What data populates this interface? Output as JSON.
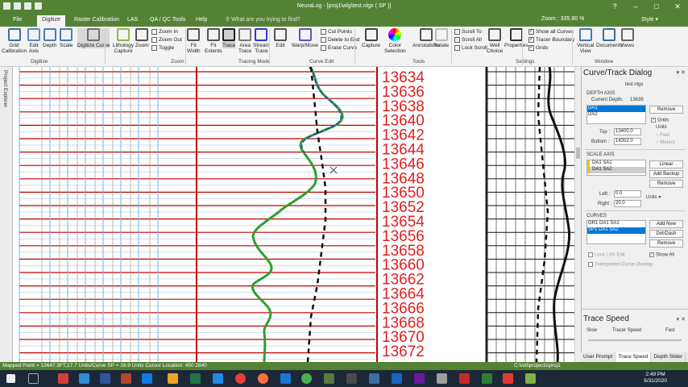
{
  "window": {
    "title": "NeuraLog - [proj1\\wlg\\test.nlgx ( SP )]"
  },
  "tabs": [
    "File",
    "Digitize",
    "Raster Calibration",
    "LAS",
    "QA / QC Tools",
    "Help"
  ],
  "active_tab": "Digitize",
  "tellme_placeholder": "What are you trying to find?",
  "zoom_label": "Zoom : 335.80 %",
  "style_label": "Style",
  "ribbon": {
    "buttons": [
      {
        "label": "Grid\nCalibration",
        "icon": "grid-calibration-icon"
      },
      {
        "label": "Edit\nAxis",
        "icon": "edit-axis-icon"
      },
      {
        "label": "Depth",
        "icon": "depth-icon"
      },
      {
        "label": "Scale",
        "icon": "scale-icon"
      },
      {
        "label": "Digitize Curve",
        "icon": "digitize-curve-icon"
      },
      {
        "label": "Lithology\nCapture",
        "icon": "lithology-icon"
      },
      {
        "label": "Zoom",
        "icon": "zoom-icon"
      },
      {
        "label": "Fit\nWidth",
        "icon": "fit-width-icon"
      },
      {
        "label": "Fit\nExtents",
        "icon": "fit-extents-icon"
      },
      {
        "label": "Trace",
        "icon": "trace-icon"
      },
      {
        "label": "Area\nTrace",
        "icon": "area-trace-icon"
      },
      {
        "label": "Stream\nTrace",
        "icon": "stream-trace-icon"
      },
      {
        "label": "Edit",
        "icon": "edit-icon"
      },
      {
        "label": "Warp/Move",
        "icon": "warp-icon"
      },
      {
        "label": "Capture",
        "icon": "capture-icon"
      },
      {
        "label": "Color\nSelection",
        "icon": "color-selection-icon"
      },
      {
        "label": "Annotations",
        "icon": "annotations-icon"
      },
      {
        "label": "Rotate",
        "icon": "rotate-icon"
      },
      {
        "label": "Well\nChoice",
        "icon": "well-choice-icon"
      },
      {
        "label": "Properties",
        "icon": "properties-icon"
      },
      {
        "label": "Vertical\nView",
        "icon": "vertical-view-icon"
      },
      {
        "label": "Documents",
        "icon": "documents-icon"
      },
      {
        "label": "Views",
        "icon": "views-icon"
      }
    ],
    "zoom_small": [
      "Zoom In",
      "Zoom Out",
      "Toggle"
    ],
    "curve_small": [
      "Cut Points",
      "Delete to End",
      "Erase Curve"
    ],
    "scroll_small": [
      "Scroll To",
      "Scroll All",
      "Lock Scroll"
    ],
    "settings_small": [
      "Show all Curves",
      "Tracer Boundary",
      "Grids"
    ],
    "groups": [
      "Digitize",
      "Zoom",
      "Tracing Mode",
      "Curve Edit",
      "Tools",
      "Settings",
      "Window"
    ]
  },
  "explorer_label": "Project Explorer",
  "depth_labels": [
    "13634",
    "13636",
    "13638",
    "13640",
    "13642",
    "13644",
    "13646",
    "13648",
    "13650",
    "13652",
    "13654",
    "13656",
    "13658",
    "13660",
    "13662",
    "13664",
    "13666",
    "13668",
    "13670",
    "13672"
  ],
  "panel": {
    "title": "Curve/Track Dialog",
    "file": "test.nlgx",
    "depth_axis": "DEPTH AXIS",
    "current_depth_label": "Current Depth:",
    "current_depth": "13639",
    "axes": [
      "DA1",
      "DA2"
    ],
    "remove": "Remove",
    "grids": "Grids",
    "units": "Units",
    "feet": "Feet",
    "meters": "Meters",
    "top_label": "Top :",
    "top": "13400.0",
    "bottom_label": "Bottom :",
    "bottom": "14352.0",
    "scale_axis": "SCALE AXIS",
    "scales": [
      "DA1 SA1",
      "DA1 SA2"
    ],
    "linear": "Linear",
    "add_backup": "Add Backup",
    "left_label": "Left :",
    "left": "0.0",
    "right_label": "Right :",
    "right": "20.0",
    "units_select": "Units",
    "curves_label": "CURVES",
    "curves": [
      "GR1 DA1 SA1",
      "SP1 DA1 SA2"
    ],
    "add_new": "Add New",
    "dot_dash": "Dot/Dash",
    "lock_las": "Lock LAS Edit",
    "show_all": "Show All",
    "transparent": "Transparent Curve Overlay",
    "trace_speed_title": "Trace Speed",
    "slow": "Slow",
    "tracer_speed": "Tracer Speed",
    "fast": "Fast",
    "bottom_tabs": [
      "User Prompt",
      "Trace Speed",
      "Depth Slider"
    ]
  },
  "status": {
    "left": "Mapped Point = 13647.3FT,17.7 Units/Curve SP = 16.9 Units Cursor Location: 450 2840",
    "right": "C:\\ndi\\projects\\proj1"
  },
  "clock": {
    "time": "2:49 PM",
    "date": "5/31/2020"
  },
  "colors": {
    "brand": "#548235",
    "depth_red": "#e02020",
    "grid_red": "#c00000",
    "trace_green": "#2ea02e",
    "trace_blue": "#2a38d8"
  }
}
